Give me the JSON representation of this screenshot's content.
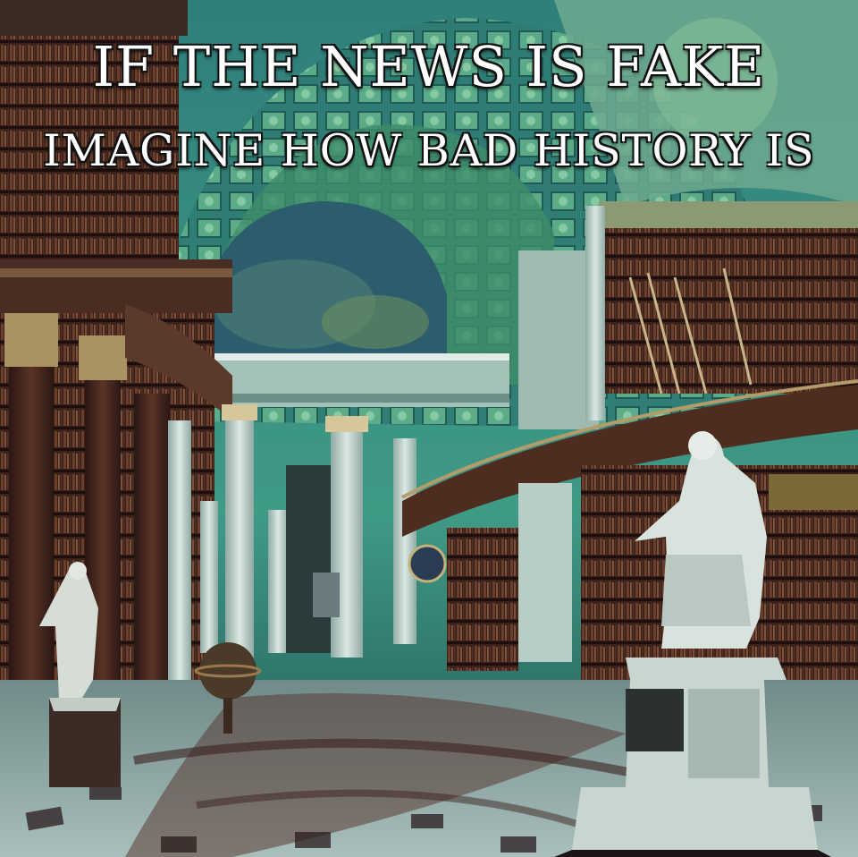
{
  "meme": {
    "line1": "IF THE NEWS IS FAKE",
    "line2": "IMAGINE HOW BAD HISTORY IS"
  },
  "palette": {
    "ceiling_teal": "#3f8f86",
    "fresco_green": "#5aa36a",
    "shelf_wood": "#4a2a20",
    "column_stone": "#b9cfc8",
    "floor_dark": "#2a1c1c",
    "floor_light": "#9fb7b3"
  }
}
